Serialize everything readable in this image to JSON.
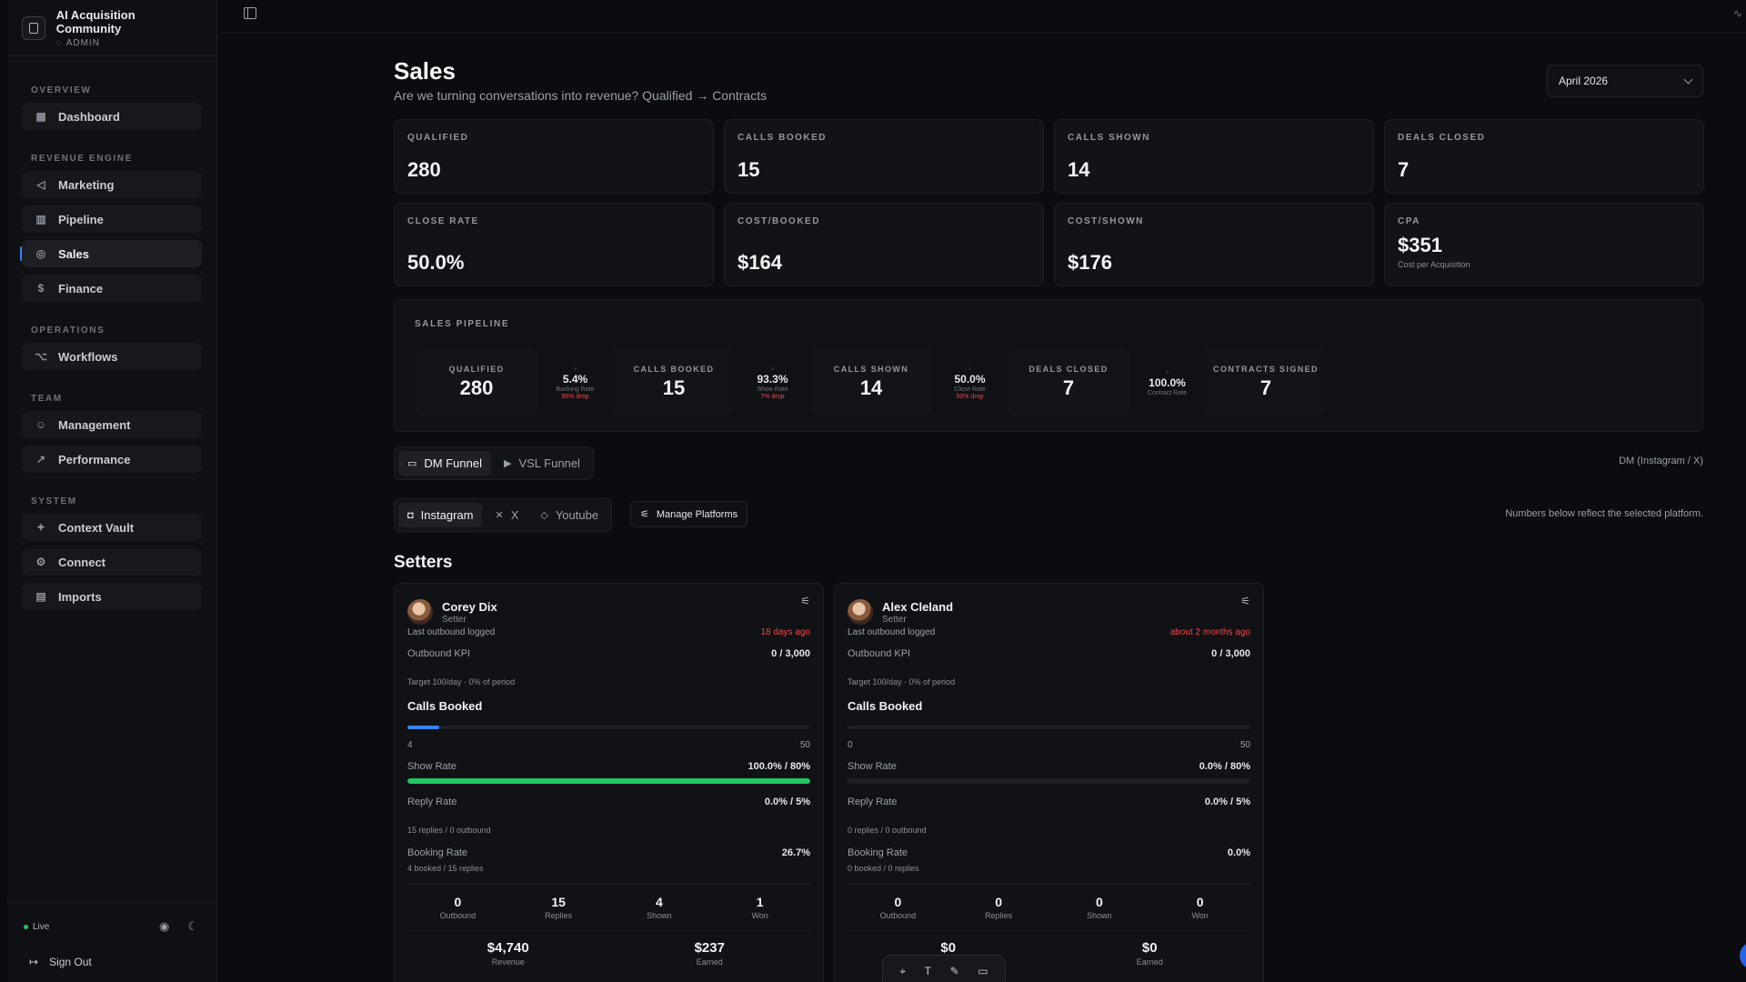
{
  "sidebar": {
    "brand_name": "AI Acquisition Community",
    "brand_role": "ADMIN",
    "sections": [
      {
        "title": "OVERVIEW",
        "items": [
          {
            "label": "Dashboard",
            "icon": "grid-icon"
          }
        ]
      },
      {
        "title": "REVENUE ENGINE",
        "items": [
          {
            "label": "Marketing",
            "icon": "megaphone-icon"
          },
          {
            "label": "Pipeline",
            "icon": "bar-chart-icon"
          },
          {
            "label": "Sales",
            "icon": "target-icon",
            "active": true
          },
          {
            "label": "Finance",
            "icon": "dollar-icon"
          }
        ]
      },
      {
        "title": "OPERATIONS",
        "items": [
          {
            "label": "Workflows",
            "icon": "workflow-icon"
          }
        ]
      },
      {
        "title": "TEAM",
        "items": [
          {
            "label": "Management",
            "icon": "users-icon"
          },
          {
            "label": "Performance",
            "icon": "trending-up-icon"
          }
        ]
      },
      {
        "title": "SYSTEM",
        "items": [
          {
            "label": "Context Vault",
            "icon": "sparkles-icon"
          },
          {
            "label": "Connect",
            "icon": "gear-icon"
          },
          {
            "label": "Imports",
            "icon": "file-icon"
          }
        ]
      }
    ],
    "live_label": "Live",
    "sign_out": "Sign Out"
  },
  "page": {
    "title": "Sales",
    "subtitle": "Are we turning conversations into revenue? Qualified → Contracts",
    "month": "April 2026"
  },
  "kpis": [
    {
      "label": "QUALIFIED",
      "value": "280"
    },
    {
      "label": "CALLS BOOKED",
      "value": "15"
    },
    {
      "label": "CALLS SHOWN",
      "value": "14"
    },
    {
      "label": "DEALS CLOSED",
      "value": "7"
    },
    {
      "label": "CLOSE RATE",
      "value": "50.0%"
    },
    {
      "label": "COST/BOOKED",
      "value": "$164"
    },
    {
      "label": "COST/SHOWN",
      "value": "$176"
    },
    {
      "label": "CPA",
      "value": "$351",
      "note": "Cost per Acquisition"
    }
  ],
  "pipeline": {
    "title": "SALES PIPELINE",
    "stages": [
      {
        "label": "QUALIFIED",
        "value": "280"
      },
      {
        "label": "CALLS BOOKED",
        "value": "15"
      },
      {
        "label": "CALLS SHOWN",
        "value": "14"
      },
      {
        "label": "DEALS CLOSED",
        "value": "7"
      },
      {
        "label": "CONTRACTS SIGNED",
        "value": "7"
      }
    ],
    "conversions": [
      {
        "pct": "5.4%",
        "name": "Booking Rate",
        "drop": "95% drop"
      },
      {
        "pct": "93.3%",
        "name": "Show Rate",
        "drop": "7% drop"
      },
      {
        "pct": "50.0%",
        "name": "Close Rate",
        "drop": "50% drop"
      },
      {
        "pct": "100.0%",
        "name": "Contract Rate",
        "drop": ""
      }
    ]
  },
  "funnel_tabs": {
    "dm": "DM Funnel",
    "vsl": "VSL Funnel",
    "note": "DM (Instagram / X)"
  },
  "platform_tabs": {
    "instagram": "Instagram",
    "x": "X",
    "youtube": "Youtube",
    "manage": "Manage Platforms",
    "note": "Numbers below reflect the selected platform."
  },
  "setters_title": "Setters",
  "setters": [
    {
      "name": "Corey Dix",
      "role": "Setter",
      "last_outbound_label": "Last outbound logged",
      "last_outbound": "18 days ago",
      "kpi_label": "Outbound KPI",
      "kpi_value": "0 / 3,000",
      "target": "Target 100/day · 0% of period",
      "calls_title": "Calls Booked",
      "calls_fill": 0.08,
      "calls_min": "4",
      "calls_max": "50",
      "show_label": "Show Rate",
      "show_value": "100.0% / 80%",
      "show_fill": 1.0,
      "reply_label": "Reply Rate",
      "reply_value": "0.0% / 5%",
      "reply_note": "15 replies / 0 outbound",
      "booking_label": "Booking Rate",
      "booking_value": "26.7%",
      "booking_note": "4 booked / 15 replies",
      "stats": [
        {
          "v": "0",
          "l": "Outbound"
        },
        {
          "v": "15",
          "l": "Replies"
        },
        {
          "v": "4",
          "l": "Shown"
        },
        {
          "v": "1",
          "l": "Won"
        }
      ],
      "money": [
        {
          "v": "$4,740",
          "l": "Revenue"
        },
        {
          "v": "$237",
          "l": "Earned"
        }
      ]
    },
    {
      "name": "Alex Cleland",
      "role": "Setter",
      "last_outbound_label": "Last outbound logged",
      "last_outbound": "about 2 months ago",
      "kpi_label": "Outbound KPI",
      "kpi_value": "0 / 3,000",
      "target": "Target 100/day · 0% of period",
      "calls_title": "Calls Booked",
      "calls_fill": 0.0,
      "calls_min": "0",
      "calls_max": "50",
      "show_label": "Show Rate",
      "show_value": "0.0% / 80%",
      "show_fill": 0.0,
      "reply_label": "Reply Rate",
      "reply_value": "0.0% / 5%",
      "reply_note": "0 replies / 0 outbound",
      "booking_label": "Booking Rate",
      "booking_value": "0.0%",
      "booking_note": "0 booked / 0 replies",
      "stats": [
        {
          "v": "0",
          "l": "Outbound"
        },
        {
          "v": "0",
          "l": "Replies"
        },
        {
          "v": "0",
          "l": "Shown"
        },
        {
          "v": "0",
          "l": "Won"
        }
      ],
      "money": [
        {
          "v": "$0",
          "l": ""
        },
        {
          "v": "$0",
          "l": "Earned"
        }
      ]
    }
  ],
  "colors": {
    "accent": "#3b82f6",
    "success": "#22c55e",
    "danger": "#ef4444"
  }
}
